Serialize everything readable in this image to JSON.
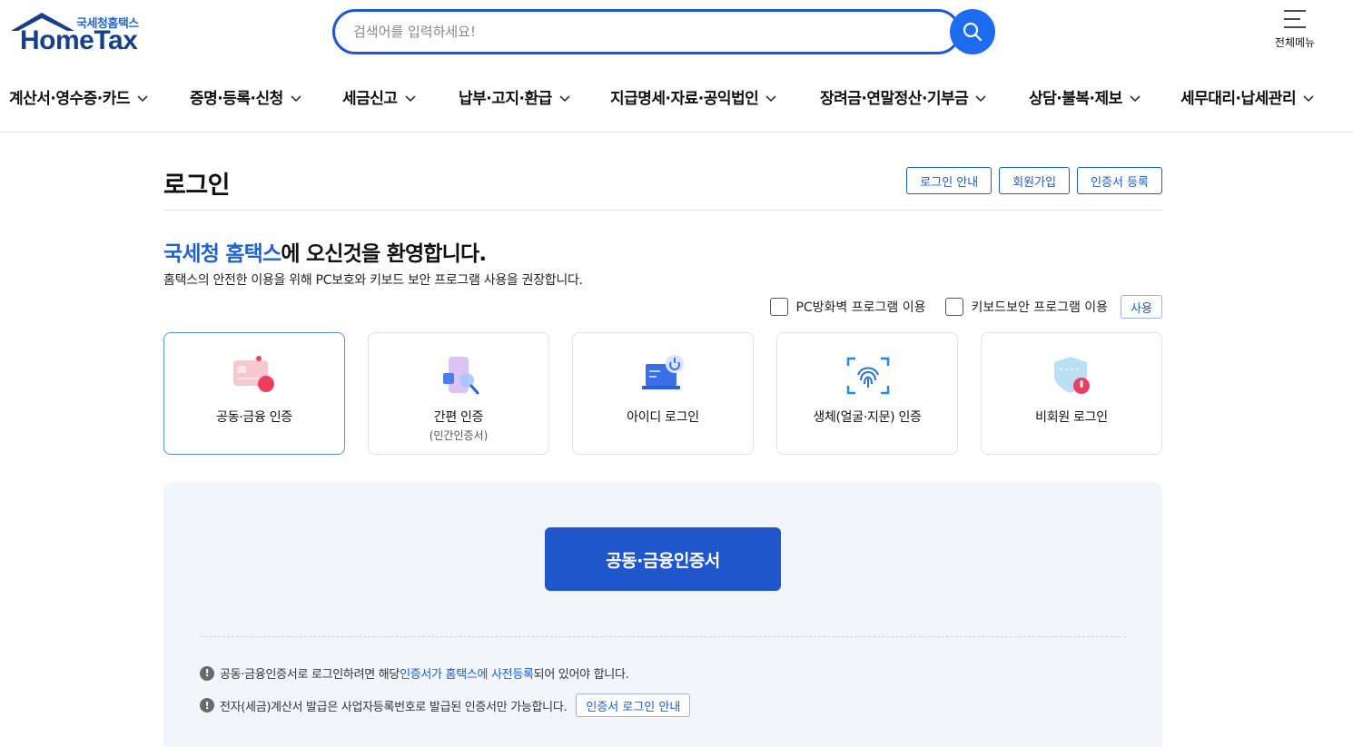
{
  "header": {
    "logo_sub": "국세청홈택스",
    "logo_main": "HomeTax",
    "search_placeholder": "검색어를 입력하세요!",
    "all_menu_label": "전체메뉴"
  },
  "gnb": [
    {
      "label": "계산서·영수증·카드"
    },
    {
      "label": "증명·등록·신청"
    },
    {
      "label": "세금신고"
    },
    {
      "label": "납부·고지·환급"
    },
    {
      "label": "지급명세·자료·공익법인"
    },
    {
      "label": "장려금·연말정산·기부금"
    },
    {
      "label": "상담·불복·제보"
    },
    {
      "label": "세무대리·납세관리"
    }
  ],
  "login": {
    "title": "로그인",
    "top_buttons": {
      "guide": "로그인 안내",
      "join": "회원가입",
      "cert_register": "인증서 등록"
    },
    "welcome_accent": "국세청 홈택스",
    "welcome_rest": "에 오신것을 환영합니다.",
    "description": "홈택스의 안전한 이용을 위해 PC보호와 키보드 보안 프로그램 사용을 권장합니다.",
    "options": {
      "firewall": "PC방화벽 프로그램 이용",
      "keyboard": "키보드보안 프로그램 이용",
      "use_button": "사용"
    },
    "methods": [
      {
        "label": "공동·금융 인증",
        "icon": "certificate-card-icon"
      },
      {
        "label": "간편 인증",
        "sub": "(민간인증서)",
        "icon": "phone-search-icon"
      },
      {
        "label": "아이디 로그인",
        "icon": "laptop-power-icon"
      },
      {
        "label": "생체(얼굴·지문) 인증",
        "icon": "fingerprint-icon"
      },
      {
        "label": "비회원 로그인",
        "icon": "shield-thermometer-icon"
      }
    ],
    "main_button": "공동·금융인증서",
    "notes": {
      "note1_pre": "공동·금융인증서로 로그인하려면 해당 ",
      "note1_link": "인증서가 홈택스에 사전등록",
      "note1_post": "되어 있어야 합니다.",
      "note2": "전자(세금)계산서 발급은 사업자등록번호로 발급된 인증서만 가능합니다.",
      "note2_button": "인증서 로그인 안내"
    }
  },
  "colors": {
    "accent": "#1a64d3",
    "primary_button": "#1f56cb",
    "search_border": "#1d56d8",
    "panel_bg": "#f2f5fa"
  }
}
